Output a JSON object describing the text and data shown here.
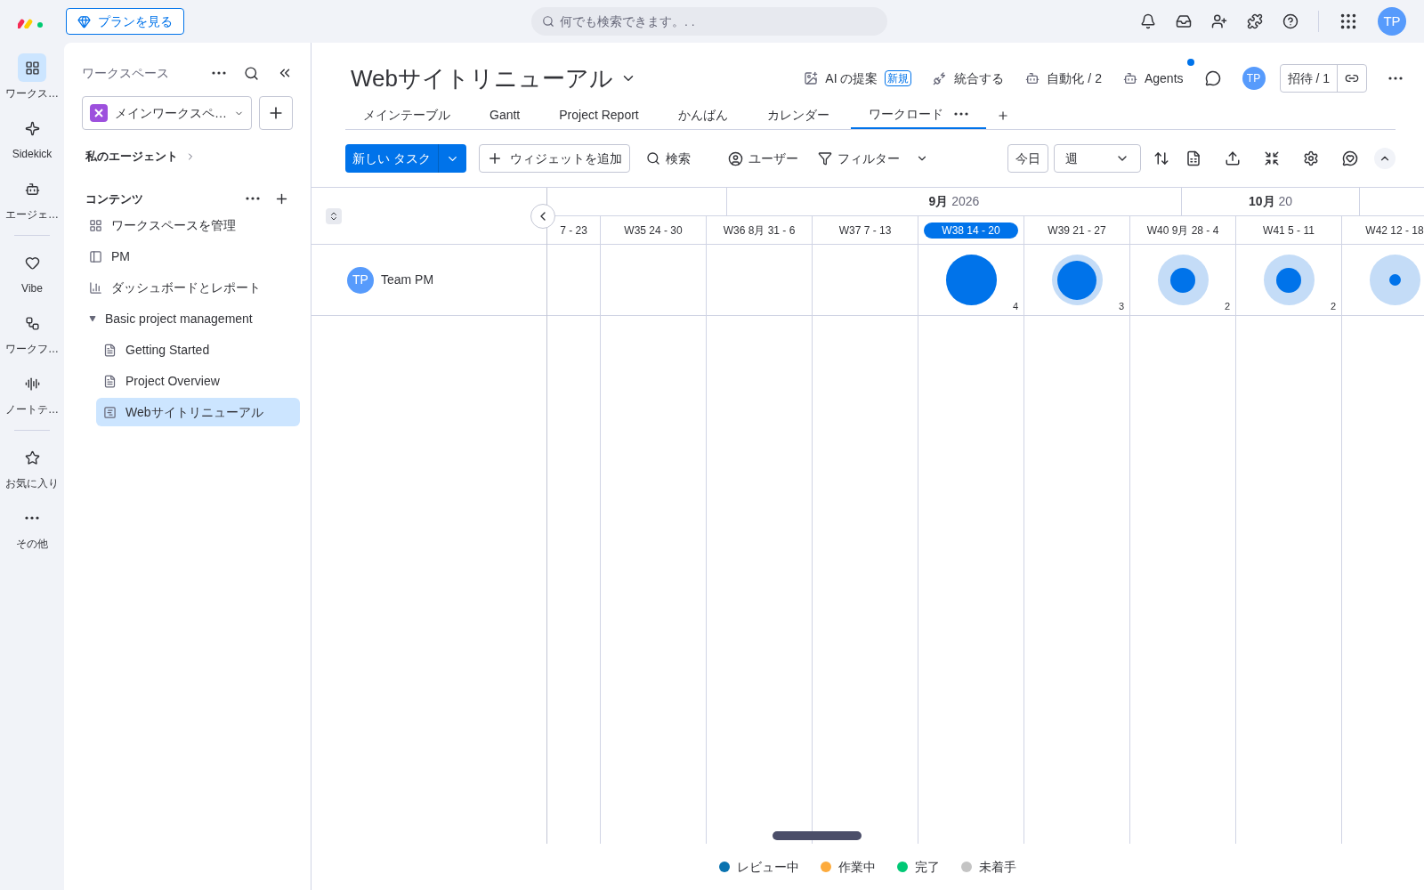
{
  "top_bar": {
    "plan_button": "プランを見る",
    "search": {
      "placeholder": "何でも検索できます。. ."
    },
    "avatar": "TP"
  },
  "rail": [
    {
      "label": "ワークス…",
      "selected": true
    },
    {
      "label": "Sidekick",
      "selected": false
    },
    {
      "label": "エージェ…",
      "selected": false
    },
    {
      "label": "Vibe",
      "selected": false
    },
    {
      "label": "ワークフ…",
      "selected": false
    },
    {
      "label": "ノートテ…",
      "selected": false
    },
    {
      "label": "お気に入り",
      "selected": false
    },
    {
      "label": "その他",
      "selected": false
    }
  ],
  "sidebar": {
    "title": "ワークスペース",
    "workspace": "メインワークスペ…",
    "agents": "私のエージェント",
    "section": "コンテンツ",
    "items": [
      {
        "kind": "manage",
        "label": "ワークスペースを管理",
        "selected": false
      },
      {
        "kind": "board",
        "label": "PM",
        "selected": false
      },
      {
        "kind": "dashboard",
        "label": "ダッシュボードとレポート",
        "selected": false
      },
      {
        "kind": "folder",
        "label": "Basic project management",
        "selected": false,
        "expanded": true,
        "children": [
          {
            "kind": "doc",
            "label": "Getting Started",
            "selected": false
          },
          {
            "kind": "doc",
            "label": "Project Overview",
            "selected": false
          },
          {
            "kind": "workload",
            "label": "Webサイトリニューアル",
            "selected": true
          }
        ]
      }
    ]
  },
  "board": {
    "title": "Webサイトリニューアル",
    "actions": [
      {
        "kind": "ai",
        "label": "AI の提案",
        "badge": "新規"
      },
      {
        "kind": "integrate",
        "label": "統合する"
      },
      {
        "kind": "automate",
        "label": "自動化 / 2"
      },
      {
        "kind": "agents",
        "label": "Agents",
        "unread": true
      }
    ],
    "avatar": "TP",
    "invite": "招待 / 1",
    "tabs": [
      {
        "label": "メインテーブル",
        "selected": false
      },
      {
        "label": "Gantt",
        "selected": false
      },
      {
        "label": "Project Report",
        "selected": false
      },
      {
        "label": "かんばん",
        "selected": false
      },
      {
        "label": "カレンダー",
        "selected": false
      },
      {
        "label": "ワークロード",
        "selected": true
      }
    ]
  },
  "toolbar": {
    "new_task": "新しい タスク",
    "add_widget": "ウィジェットを追加",
    "search": "検索",
    "person": "ユーザー",
    "filter": "フィルター",
    "today": "今日",
    "period": "週"
  },
  "timeline": {
    "months": [
      {
        "label": "**9月** 2026"
      },
      {
        "label": "**10月** 20"
      }
    ],
    "weeks": [
      {
        "label": "7 - 23",
        "selected": false
      },
      {
        "label": "W35 24 - 30",
        "selected": false
      },
      {
        "label": "W36 8月 31 - 6",
        "selected": false
      },
      {
        "label": "W37 7 - 13",
        "selected": false
      },
      {
        "label": "W38 14 - 20",
        "selected": true
      },
      {
        "label": "W39 21 - 27",
        "selected": false
      },
      {
        "label": "W40 9月 28 - 4",
        "selected": false
      },
      {
        "label": "W41 5 - 11",
        "selected": false
      },
      {
        "label": "W42 12 - 18",
        "selected": false
      }
    ],
    "rows": [
      {
        "avatar": "TP",
        "name": "Team PM",
        "cells": [
          {
            "kind": "none"
          },
          {
            "kind": "none"
          },
          {
            "kind": "none"
          },
          {
            "kind": "none"
          },
          {
            "kind": "full",
            "count": "4"
          },
          {
            "kind": "large",
            "count": "3"
          },
          {
            "kind": "medium",
            "count": "2"
          },
          {
            "kind": "medium",
            "count": "2"
          },
          {
            "kind": "small"
          }
        ]
      }
    ],
    "legend": [
      {
        "label": "レビュー中",
        "color": "#0a73b0"
      },
      {
        "label": "作業中",
        "color": "#fdab3d"
      },
      {
        "label": "完了",
        "color": "#00c875"
      },
      {
        "label": "未着手",
        "color": "#c4c4c4"
      }
    ]
  }
}
